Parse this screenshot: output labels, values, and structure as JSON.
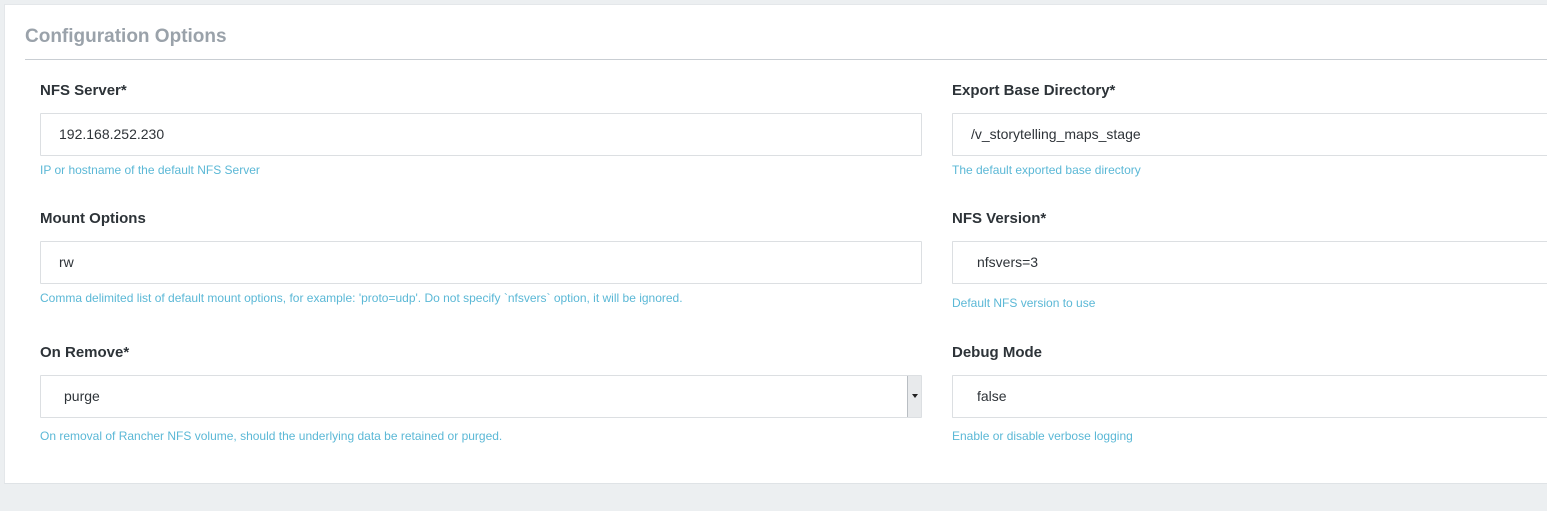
{
  "section": {
    "title": "Configuration Options"
  },
  "fields": {
    "nfs_server": {
      "label": "NFS Server*",
      "value": "192.168.252.230",
      "help": "IP or hostname of the default NFS Server"
    },
    "export_base_directory": {
      "label": "Export Base Directory*",
      "value": "/v_storytelling_maps_stage",
      "help": "The default exported base directory"
    },
    "mount_options": {
      "label": "Mount Options",
      "value": "rw",
      "help": "Comma delimited list of default mount options, for example: 'proto=udp'. Do not specify `nfsvers` option, it will be ignored."
    },
    "nfs_version": {
      "label": "NFS Version*",
      "value": "nfsvers=3",
      "help": "Default NFS version to use"
    },
    "on_remove": {
      "label": "On Remove*",
      "selected": "purge",
      "help": "On removal of Rancher NFS volume, should the underlying data be retained or purged."
    },
    "debug_mode": {
      "label": "Debug Mode",
      "value": "false",
      "help": "Enable or disable verbose logging"
    }
  },
  "icons": {
    "on_remove_dropdown": "caret-down-icon"
  },
  "colors": {
    "help_text": "#5bb8d6",
    "section_title": "#9aa2aa",
    "label": "#2d3338",
    "page_background": "#eceff1"
  }
}
